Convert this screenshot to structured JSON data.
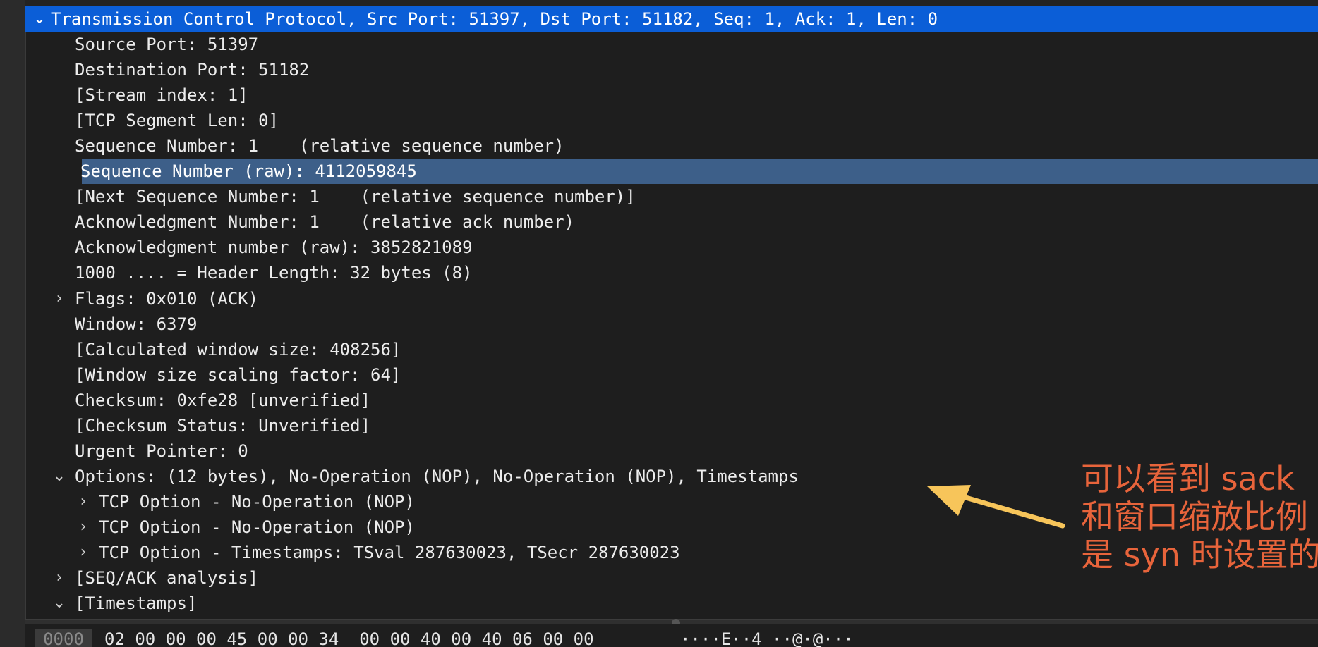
{
  "header": {
    "label": "Transmission Control Protocol, Src Port: 51397, Dst Port: 51182, Seq: 1, Ack: 1, Len: 0",
    "expanded": true
  },
  "fields": [
    {
      "label": "Source Port: 51397"
    },
    {
      "label": "Destination Port: 51182"
    },
    {
      "label": "[Stream index: 1]"
    },
    {
      "label": "[TCP Segment Len: 0]"
    },
    {
      "label": "Sequence Number: 1    (relative sequence number)"
    },
    {
      "label": "Sequence Number (raw): 4112059845",
      "selected": true
    },
    {
      "label": "[Next Sequence Number: 1    (relative sequence number)]"
    },
    {
      "label": "Acknowledgment Number: 1    (relative ack number)"
    },
    {
      "label": "Acknowledgment number (raw): 3852821089"
    },
    {
      "label": "1000 .... = Header Length: 32 bytes (8)"
    },
    {
      "label": "Flags: 0x010 (ACK)",
      "toggle": "collapsed"
    },
    {
      "label": "Window: 6379"
    },
    {
      "label": "[Calculated window size: 408256]"
    },
    {
      "label": "[Window size scaling factor: 64]"
    },
    {
      "label": "Checksum: 0xfe28 [unverified]"
    },
    {
      "label": "[Checksum Status: Unverified]"
    },
    {
      "label": "Urgent Pointer: 0"
    },
    {
      "label": "Options: (12 bytes), No-Operation (NOP), No-Operation (NOP), Timestamps",
      "toggle": "expanded"
    },
    {
      "label": "TCP Option - No-Operation (NOP)",
      "toggle": "collapsed",
      "nested": true
    },
    {
      "label": "TCP Option - No-Operation (NOP)",
      "toggle": "collapsed",
      "nested": true
    },
    {
      "label": "TCP Option - Timestamps: TSval 287630023, TSecr 287630023",
      "toggle": "collapsed",
      "nested": true
    },
    {
      "label": "[SEQ/ACK analysis]",
      "toggle": "collapsed"
    },
    {
      "label": "[Timestamps]",
      "toggle": "expanded"
    }
  ],
  "annotation": {
    "lines": [
      "可以看到 sack",
      "和窗口缩放比例",
      "是 syn 时设置的"
    ],
    "color": "#e8643b",
    "arrow_color": "#f7c55a"
  },
  "bytes": {
    "offset": "0000",
    "hex": "02 00 00 00 45 00 00 34  00 00 40 00 40 06 00 00",
    "ascii": "····E··4 ··@·@···"
  },
  "colors": {
    "header_bg": "#0b5ed7",
    "selected_bg": "#3d5f89",
    "background": "#1e1e1e"
  },
  "icons": {
    "expanded": "chevron-down-icon",
    "collapsed": "chevron-right-icon"
  }
}
